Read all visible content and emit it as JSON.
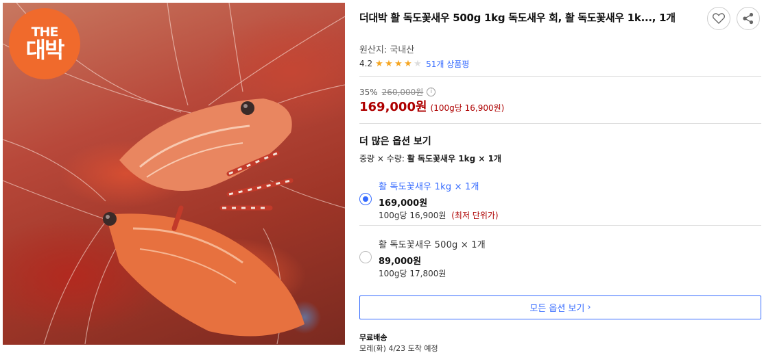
{
  "product": {
    "title": "더대박 활 독도꽃새우 500g 1kg 독도새우 회, 활 독도꽃새우 1k..., 1개",
    "origin": "원산지: 국내산",
    "rating_value": "4.2",
    "rating_stars": 4,
    "review_count": "51개 상품평"
  },
  "image": {
    "brand_logo_line1": "THE",
    "brand_logo_line2": "대박"
  },
  "pricing": {
    "discount_rate": "35%",
    "original_price": "260,000원",
    "sale_price": "169,000원",
    "unit_price": "(100g당 16,900원)"
  },
  "options": {
    "heading": "더 많은 옵션 보기",
    "summary_label": "중량 × 수량:",
    "summary_value": "활 독도꽃새우 1kg × 1개",
    "items": [
      {
        "name": "활 독도꽃새우 1kg × 1개",
        "price": "169,000원",
        "unit": "100g당 16,900원",
        "tag": "(최저 단위가)",
        "selected": true
      },
      {
        "name": "활 독도꽃새우 500g × 1개",
        "price": "89,000원",
        "unit": "100g당 17,800원",
        "tag": "",
        "selected": false
      }
    ],
    "all_options_button": "모든 옵션 보기"
  },
  "shipping": {
    "label": "무료배송",
    "eta": "모레(화) 4/23 도착 예정"
  },
  "colors": {
    "accent": "#346aff",
    "price_red": "#ae0000",
    "star": "#f5a623",
    "logo": "#f06a2c"
  }
}
